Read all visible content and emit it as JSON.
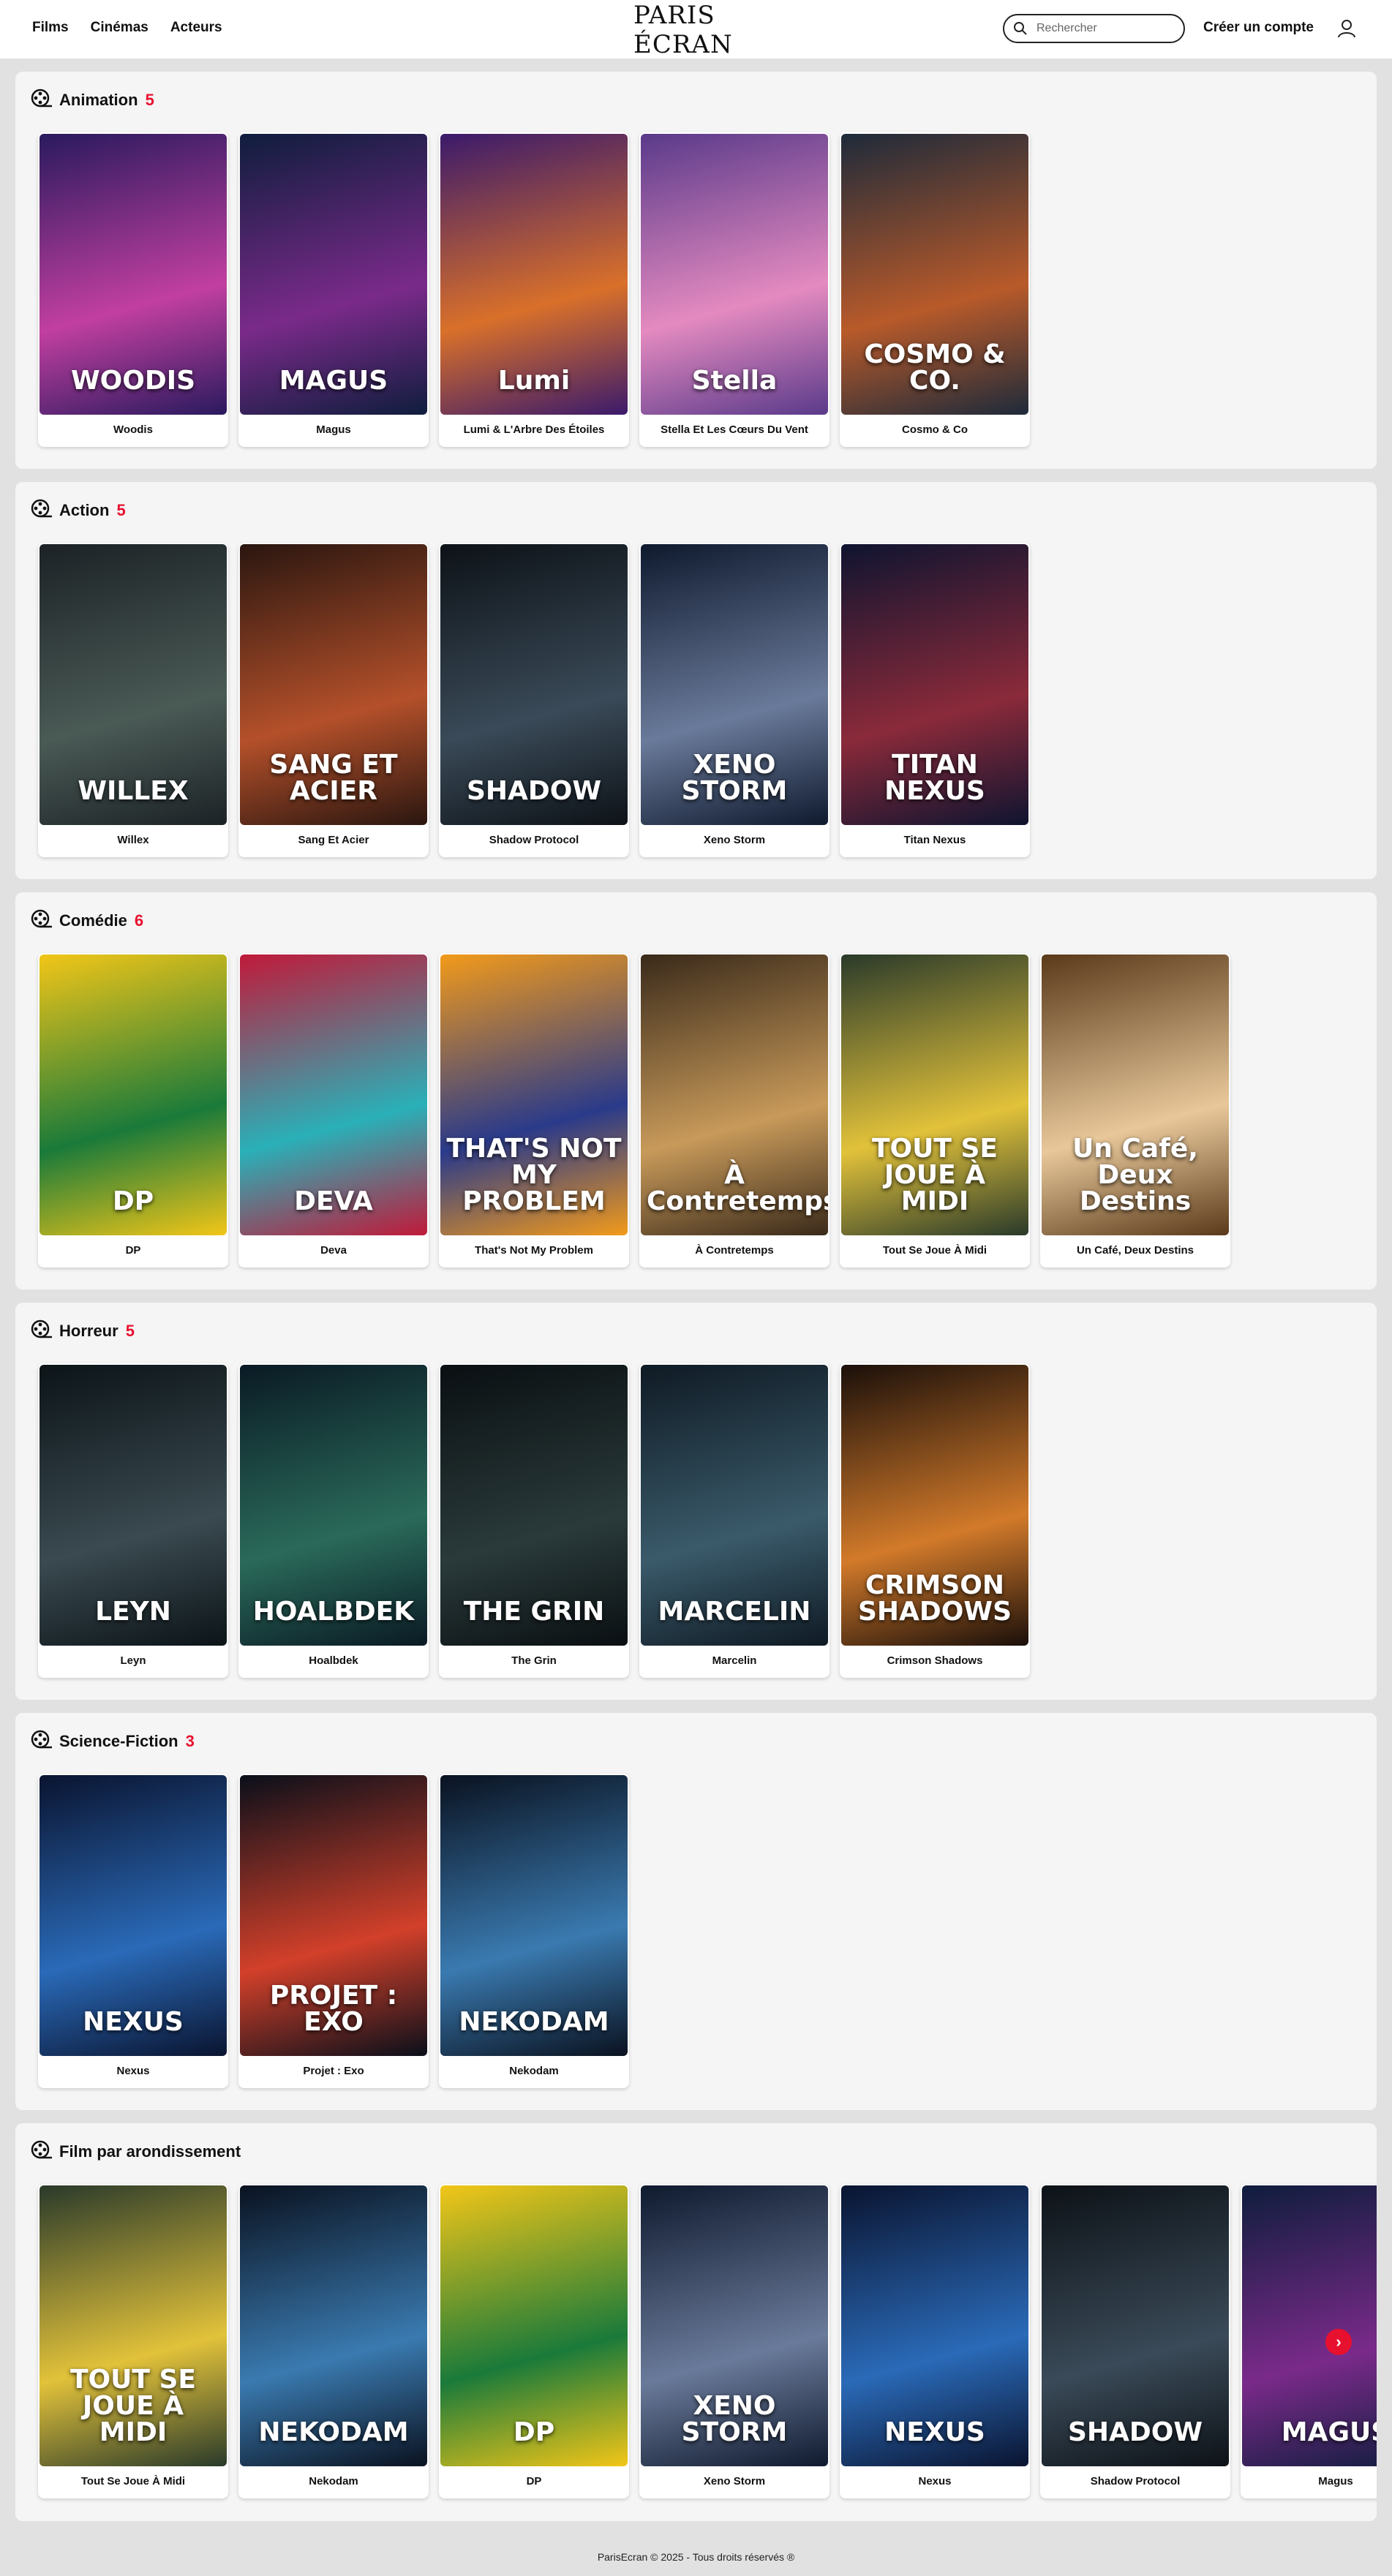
{
  "header": {
    "nav": [
      "Films",
      "Cinémas",
      "Acteurs"
    ],
    "logo": "PARIS ÉCRAN",
    "search_placeholder": "Rechercher",
    "signup": "Créer un compte"
  },
  "sections": [
    {
      "title": "Animation",
      "count": "5",
      "movies": [
        {
          "title": "Woodis",
          "poster_text": "WOODIS",
          "colors": [
            "#2a1a5e",
            "#c13fa0"
          ]
        },
        {
          "title": "Magus",
          "poster_text": "MAGUS",
          "colors": [
            "#0f1d3d",
            "#7a2a8a"
          ]
        },
        {
          "title": "Lumi & L'Arbre Des Étoiles",
          "poster_text": "Lumi",
          "colors": [
            "#3b1a6b",
            "#d9702a"
          ]
        },
        {
          "title": "Stella Et Les Cœurs Du Vent",
          "poster_text": "Stella",
          "colors": [
            "#5a3a8a",
            "#e48ac0"
          ]
        },
        {
          "title": "Cosmo & Co",
          "poster_text": "COSMO & CO.",
          "colors": [
            "#1e2a3a",
            "#b85a2a"
          ]
        }
      ]
    },
    {
      "title": "Action",
      "count": "5",
      "movies": [
        {
          "title": "Willex",
          "poster_text": "WILLEX",
          "colors": [
            "#1c2226",
            "#4a5a55"
          ]
        },
        {
          "title": "Sang Et Acier",
          "poster_text": "SANG ET ACIER",
          "colors": [
            "#2a1610",
            "#b4502a"
          ]
        },
        {
          "title": "Shadow Protocol",
          "poster_text": "SHADOW",
          "colors": [
            "#0d1217",
            "#3a4a58"
          ]
        },
        {
          "title": "Xeno Storm",
          "poster_text": "XENO STORM",
          "colors": [
            "#0f1a2e",
            "#6a7a9a"
          ]
        },
        {
          "title": "Titan Nexus",
          "poster_text": "TITAN NEXUS",
          "colors": [
            "#0f1430",
            "#8a2a3a"
          ]
        }
      ]
    },
    {
      "title": "Comédie",
      "count": "6",
      "movies": [
        {
          "title": "DP",
          "poster_text": "DP",
          "colors": [
            "#f2c618",
            "#1a7a3a"
          ]
        },
        {
          "title": "Deva",
          "poster_text": "DEVA",
          "colors": [
            "#c01a3a",
            "#2ab0b8"
          ]
        },
        {
          "title": "That's Not My Problem",
          "poster_text": "THAT'S NOT MY PROBLEM",
          "colors": [
            "#f29a1a",
            "#2a3a8a"
          ]
        },
        {
          "title": "À Contretemps",
          "poster_text": "À Contretemps",
          "colors": [
            "#3a2a1a",
            "#c89a5a"
          ]
        },
        {
          "title": "Tout Se Joue À Midi",
          "poster_text": "TOUT SE JOUE À MIDI",
          "colors": [
            "#2a3a2a",
            "#e2c23a"
          ]
        },
        {
          "title": "Un Café, Deux Destins",
          "poster_text": "Un Café, Deux Destins",
          "colors": [
            "#5a3a1a",
            "#e8c89a"
          ]
        }
      ]
    },
    {
      "title": "Horreur",
      "count": "5",
      "movies": [
        {
          "title": "Leyn",
          "poster_text": "LEYN",
          "colors": [
            "#0c1418",
            "#3a4a50"
          ]
        },
        {
          "title": "Hoalbdek",
          "poster_text": "HOALBDEK",
          "colors": [
            "#0a1a24",
            "#2a6a5a"
          ]
        },
        {
          "title": "The Grin",
          "poster_text": "THE GRIN",
          "colors": [
            "#0a0f12",
            "#2a3a3a"
          ]
        },
        {
          "title": "Marcelin",
          "poster_text": "MARCELIN",
          "colors": [
            "#0f1a24",
            "#3a5a6a"
          ]
        },
        {
          "title": "Crimson Shadows",
          "poster_text": "CRIMSON SHADOWS",
          "colors": [
            "#1a0f0a",
            "#d27a2a"
          ]
        }
      ]
    },
    {
      "title": "Science-Fiction",
      "count": "3",
      "movies": [
        {
          "title": "Nexus",
          "poster_text": "NEXUS",
          "colors": [
            "#0a1430",
            "#2a6ab8"
          ]
        },
        {
          "title": "Projet : Exo",
          "poster_text": "PROJET : EXO",
          "colors": [
            "#0a0f1a",
            "#d2402a"
          ]
        },
        {
          "title": "Nekodam",
          "poster_text": "NEKODAM",
          "colors": [
            "#0a1220",
            "#3a7ab0"
          ]
        }
      ]
    },
    {
      "title": "Film par arondissement",
      "count": "",
      "movies": [
        {
          "title": "Tout Se Joue À Midi",
          "poster_text": "TOUT SE JOUE À MIDI",
          "colors": [
            "#2a3a2a",
            "#e2c23a"
          ]
        },
        {
          "title": "Nekodam",
          "poster_text": "NEKODAM",
          "colors": [
            "#0a1220",
            "#3a7ab0"
          ]
        },
        {
          "title": "DP",
          "poster_text": "DP",
          "colors": [
            "#f2c618",
            "#1a7a3a"
          ]
        },
        {
          "title": "Xeno Storm",
          "poster_text": "XENO STORM",
          "colors": [
            "#0f1a2e",
            "#6a7a9a"
          ]
        },
        {
          "title": "Nexus",
          "poster_text": "NEXUS",
          "colors": [
            "#0a1430",
            "#2a6ab8"
          ]
        },
        {
          "title": "Shadow Protocol",
          "poster_text": "SHADOW",
          "colors": [
            "#0d1217",
            "#3a4a58"
          ]
        },
        {
          "title": "Magus",
          "poster_text": "MAGUS",
          "colors": [
            "#0f1d3d",
            "#7a2a8a"
          ]
        }
      ]
    }
  ],
  "footer": "ParisEcran © 2025 - Tous droits réservés ®",
  "accent_color": "#e8102f"
}
